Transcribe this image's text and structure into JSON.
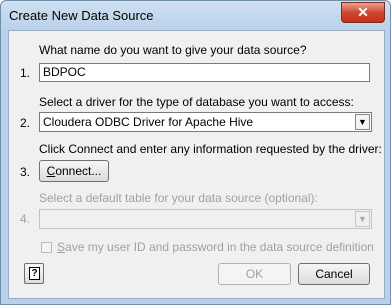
{
  "window": {
    "title": "Create New Data Source",
    "close_glyph": "✕"
  },
  "step1": {
    "number": "1.",
    "prompt": "What name do you want to give your data source?",
    "value": "BDPOC"
  },
  "step2": {
    "number": "2.",
    "prompt": "Select a driver for the type of database you want to access:",
    "selected": "Cloudera ODBC Driver for Apache Hive"
  },
  "step3": {
    "number": "3.",
    "prompt": "Click Connect and enter any information requested by the driver:",
    "connect_pre": "",
    "connect_ul": "C",
    "connect_post": "onnect..."
  },
  "step4": {
    "number": "4.",
    "prompt": "Select a default table for your data source (optional):",
    "selected": ""
  },
  "save_credentials": {
    "pre": "",
    "ul": "S",
    "post": "ave my user ID and password in the data source definition",
    "checked": false
  },
  "buttons": {
    "help_glyph": "?",
    "ok": "OK",
    "cancel": "Cancel"
  },
  "icons": {
    "dropdown": "dropdown-arrow-icon",
    "help": "help-icon",
    "close": "close-icon"
  }
}
